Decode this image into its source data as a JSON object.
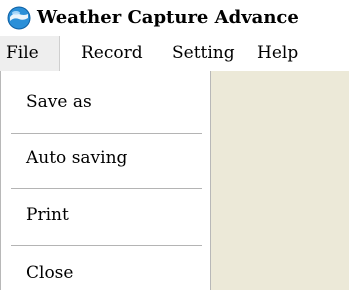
{
  "window": {
    "title": "Weather Capture Advance"
  },
  "menu_bar": {
    "items": [
      {
        "label": "File"
      },
      {
        "label": "Record"
      },
      {
        "label": "Setting"
      },
      {
        "label": "Help"
      }
    ]
  },
  "file_menu": {
    "items": [
      {
        "label": "Save as"
      },
      {
        "label": "Auto saving"
      },
      {
        "label": "Print"
      },
      {
        "label": "Close"
      }
    ]
  },
  "colors": {
    "client_background": "#ece9d8",
    "menu_background": "#ffffff",
    "icon_blue": "#2a8fd8"
  },
  "icons": {
    "app": "weather-globe-icon"
  }
}
